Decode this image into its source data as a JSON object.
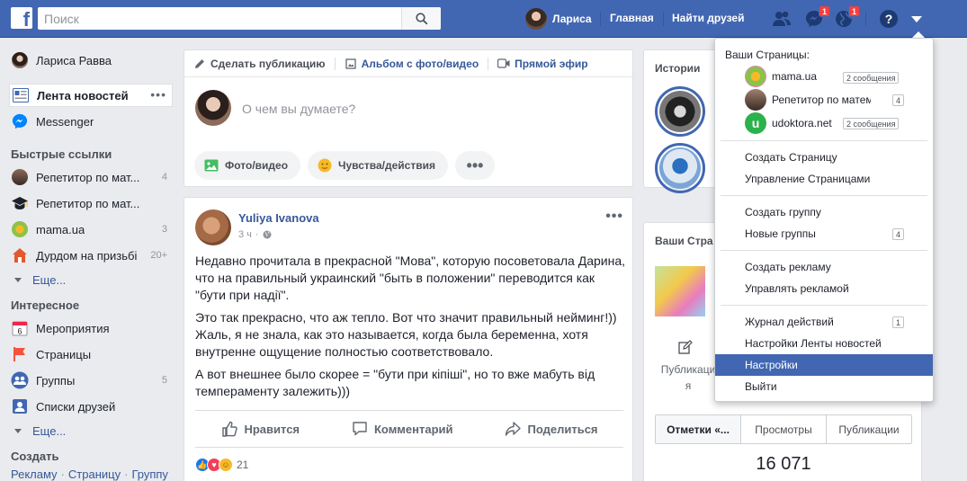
{
  "topbar": {
    "search_placeholder": "Поиск",
    "user_name": "Лариса",
    "home": "Главная",
    "find_friends": "Найти друзей",
    "messages_badge": "1",
    "notifications_badge": "1"
  },
  "leftnav": {
    "profile": "Лариса Равва",
    "feed": "Лента новостей",
    "messenger": "Messenger",
    "shortcuts_head": "Быстрые ссылки",
    "shortcuts": [
      {
        "label": "Репетитор по мат...",
        "count": "4"
      },
      {
        "label": "Репетитор по мат...",
        "count": ""
      },
      {
        "label": "mama.ua",
        "count": "3"
      },
      {
        "label": "Дурдом на призьбі",
        "count": "20+"
      }
    ],
    "more1": "Еще...",
    "explore_head": "Интересное",
    "explore": [
      {
        "label": "Мероприятия",
        "count": "",
        "icon_text": "6"
      },
      {
        "label": "Страницы",
        "count": ""
      },
      {
        "label": "Группы",
        "count": "5"
      },
      {
        "label": "Списки друзей",
        "count": ""
      }
    ],
    "more2": "Еще...",
    "create_head": "Создать",
    "create_links": [
      "Рекламу",
      "Страницу",
      "Группу"
    ]
  },
  "composer": {
    "tab_post": "Сделать публикацию",
    "tab_album": "Альбом с фото/видео",
    "tab_live": "Прямой эфир",
    "placeholder": "О чем вы думаете?",
    "btn_photo": "Фото/видео",
    "btn_feeling": "Чувства/действия",
    "btn_more": "•••"
  },
  "post": {
    "author": "Yuliya Ivanova",
    "time": "3 ч",
    "paragraphs": [
      "Недавно прочитала в прекрасной \"Мова\", которую посоветовала Дарина, что на правильный украинский \"быть в положении\" переводится как \"бути при надії\".",
      "Это так прекрасно, что аж тепло. Вот что значит правильный нейминг!)) Жаль, я не знала, как это называется, когда была беременна, хотя внутренне ощущение полностью соответствовало.",
      "А вот внешнее было скорее = \"бути при кіпіші\", но то вже мабуть від темпераменту залежить)))"
    ],
    "like": "Нравится",
    "comment": "Комментарий",
    "share": "Поделиться",
    "reactions_count": "21",
    "dots": "•••"
  },
  "right": {
    "stories_title": "Истории",
    "pages_title": "Ваши Стра",
    "pub_label_1": "Публикаци",
    "pub_label_2": "я",
    "tabs": [
      "Отметки «...",
      "Просмотры",
      "Публикации"
    ],
    "big_number": "16 071"
  },
  "dropdown": {
    "head": "Ваши Страницы:",
    "pages": [
      {
        "name": "mama.ua",
        "badge": "2 сообщения"
      },
      {
        "name": "Репетитор по матема...",
        "badge": "4"
      },
      {
        "name": "udoktora.net",
        "badge": "2 сообщения"
      }
    ],
    "create_page": "Создать Страницу",
    "manage_pages": "Управление Страницами",
    "create_group": "Создать группу",
    "new_groups": "Новые группы",
    "new_groups_badge": "4",
    "create_ad": "Создать рекламу",
    "manage_ads": "Управлять рекламой",
    "activity_log": "Журнал действий",
    "activity_badge": "1",
    "feed_settings": "Настройки Ленты новостей",
    "settings": "Настройки",
    "logout": "Выйти"
  },
  "colors": {
    "brand": "#4267b2",
    "link": "#365899",
    "badge": "#fa3e3e"
  }
}
